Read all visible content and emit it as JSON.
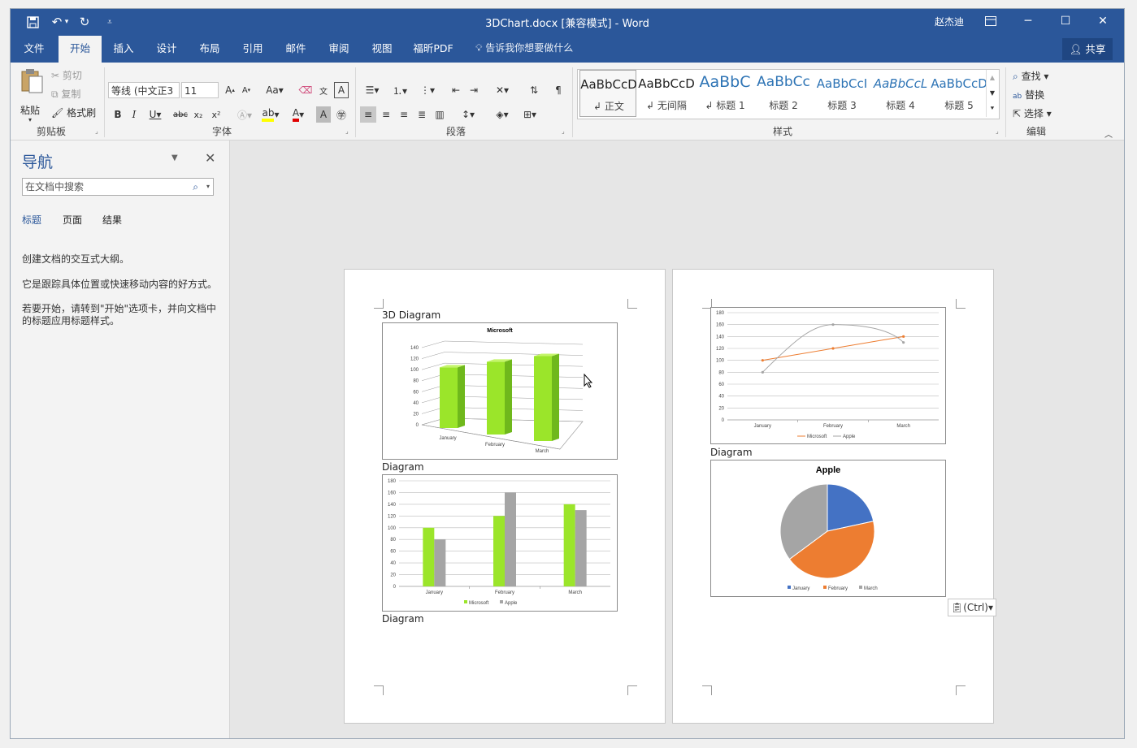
{
  "window": {
    "title": "3DChart.docx [兼容模式]  -  Word",
    "user": "赵杰迪",
    "qat": {
      "save_icon": "save-icon",
      "undo_icon": "undo-icon",
      "redo_icon": "redo-icon",
      "customize_icon": "customize-qat-icon"
    }
  },
  "tabs": [
    "文件",
    "开始",
    "插入",
    "设计",
    "布局",
    "引用",
    "邮件",
    "审阅",
    "视图",
    "福昕PDF"
  ],
  "active_tab": "开始",
  "tellme": "告诉我你想要做什么",
  "share": "共享",
  "ribbon": {
    "clipboard": {
      "label": "剪贴板",
      "paste": "粘贴",
      "cut": "剪切",
      "copy": "复制",
      "format_painter": "格式刷"
    },
    "font": {
      "label": "字体",
      "font_name": "等线 (中文正3",
      "font_size": "11",
      "aa": "Aa",
      "case_label": "Aa"
    },
    "paragraph": {
      "label": "段落"
    },
    "styles": {
      "label": "样式",
      "items": [
        {
          "sample": "AaBbCcD",
          "name": "正文",
          "color": "#000000"
        },
        {
          "sample": "AaBbCcD",
          "name": "无间隔",
          "color": "#000000"
        },
        {
          "sample": "AaBbC",
          "name": "标题 1",
          "color": "#2e74b5"
        },
        {
          "sample": "AaBbCc",
          "name": "标题 2",
          "color": "#2e74b5"
        },
        {
          "sample": "AaBbCcI",
          "name": "标题 3",
          "color": "#2e74b5"
        },
        {
          "sample": "AaBbCcL",
          "name": "标题 4",
          "color": "#2e74b5"
        },
        {
          "sample": "AaBbCcD",
          "name": "标题 5",
          "color": "#2e74b5"
        }
      ]
    },
    "editing": {
      "label": "编辑",
      "find": "查找",
      "replace": "替换",
      "select": "选择"
    }
  },
  "nav": {
    "title": "导航",
    "search_placeholder": "在文档中搜索",
    "tabs": [
      "标题",
      "页面",
      "结果"
    ],
    "text1": "创建文档的交互式大纲。",
    "text2": "它是跟踪具体位置或快速移动内容的好方式。",
    "text3": "若要开始，请转到\"开始\"选项卡，并向文档中的标题应用标题样式。"
  },
  "document": {
    "captions": {
      "c1": "3D Diagram",
      "c2": "Diagram",
      "c3": "Diagram",
      "c4": "Diagram"
    },
    "paste_options": "(Ctrl)"
  },
  "chart_data": [
    {
      "type": "bar",
      "title": "Microsoft",
      "3d": true,
      "categories": [
        "January",
        "February",
        "March"
      ],
      "series": [
        {
          "name": "Microsoft",
          "values": [
            100,
            120,
            140
          ]
        }
      ],
      "ylim": [
        0,
        140
      ],
      "yticks": [
        0,
        20,
        40,
        60,
        80,
        100,
        120,
        140
      ],
      "color": "#9be52a"
    },
    {
      "type": "bar",
      "title": "",
      "categories": [
        "January",
        "February",
        "March"
      ],
      "series": [
        {
          "name": "Microsoft",
          "values": [
            100,
            120,
            140
          ],
          "color": "#9be52a"
        },
        {
          "name": "Apple",
          "values": [
            80,
            160,
            130
          ],
          "color": "#a5a5a5"
        }
      ],
      "ylim": [
        0,
        180
      ],
      "yticks": [
        0,
        20,
        40,
        60,
        80,
        100,
        120,
        140,
        160,
        180
      ],
      "legend": "bottom"
    },
    {
      "type": "line",
      "title": "",
      "categories": [
        "January",
        "February",
        "March"
      ],
      "series": [
        {
          "name": "Microsoft",
          "values": [
            100,
            120,
            140
          ],
          "color": "#ed7d31"
        },
        {
          "name": "Apple",
          "values": [
            80,
            160,
            130
          ],
          "color": "#a5a5a5"
        }
      ],
      "ylim": [
        0,
        180
      ],
      "yticks": [
        0,
        20,
        40,
        60,
        80,
        100,
        120,
        140,
        160,
        180
      ],
      "legend": "bottom"
    },
    {
      "type": "pie",
      "title": "Apple",
      "categories": [
        "January",
        "February",
        "March"
      ],
      "values": [
        80,
        160,
        130
      ],
      "colors": [
        "#4472c4",
        "#ed7d31",
        "#a5a5a5"
      ],
      "legend": "bottom"
    }
  ]
}
